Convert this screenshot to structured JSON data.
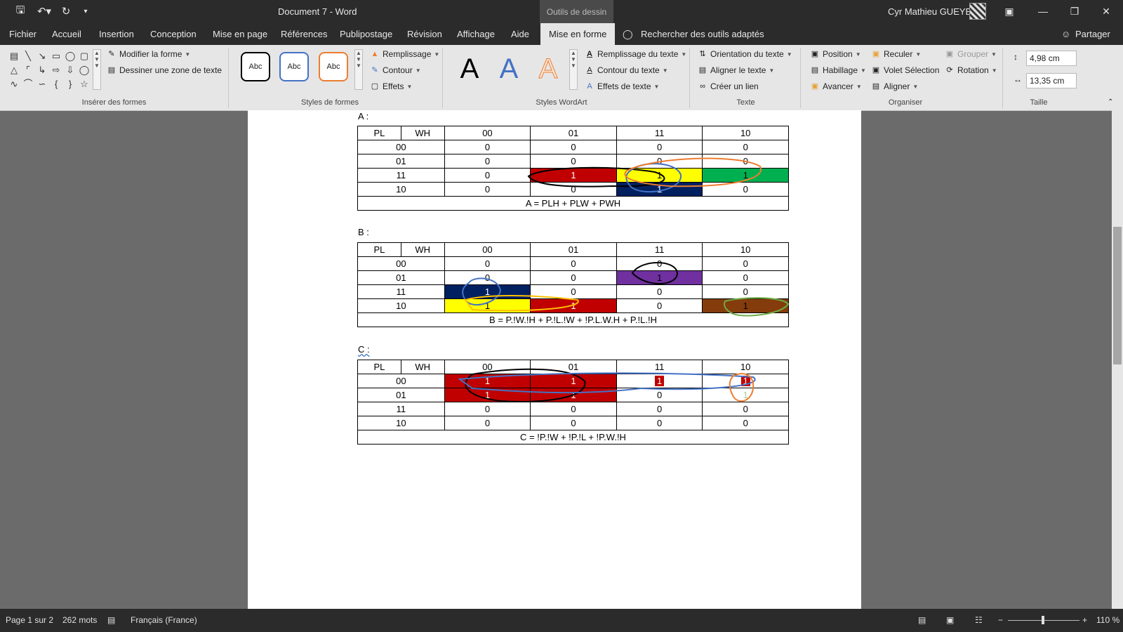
{
  "app": {
    "doc_title": "Document 7  -  Word",
    "contextual_tab": "Outils de dessin",
    "user": "Cyr Mathieu GUEYE"
  },
  "tabs": [
    "Fichier",
    "Accueil",
    "Insertion",
    "Conception",
    "Mise en page",
    "Références",
    "Publipostage",
    "Révision",
    "Affichage",
    "Aide",
    "Mise en forme"
  ],
  "tell_me": "Rechercher des outils adaptés",
  "share": "Partager",
  "ribbon": {
    "insert_shapes": {
      "edit_shape": "Modifier la forme",
      "draw_textbox": "Dessiner une zone de texte",
      "label": "Insérer des formes"
    },
    "shape_styles": {
      "sample": "Abc",
      "fill": "Remplissage",
      "outline": "Contour",
      "effects": "Effets",
      "label": "Styles de formes"
    },
    "wordart": {
      "sample": "A",
      "text_fill": "Remplissage du texte",
      "text_outline": "Contour du texte",
      "text_effects": "Effets de texte",
      "label": "Styles WordArt"
    },
    "text": {
      "orientation": "Orientation du texte",
      "align": "Aligner le texte",
      "link": "Créer un lien",
      "label": "Texte"
    },
    "arrange": {
      "position": "Position",
      "wrap": "Habillage",
      "forward": "Avancer",
      "backward": "Reculer",
      "selection_pane": "Volet Sélection",
      "align": "Aligner",
      "group": "Grouper",
      "rotate": "Rotation",
      "label": "Organiser"
    },
    "size": {
      "height": "4,98 cm",
      "width": "13,35 cm",
      "label": "Taille"
    }
  },
  "document": {
    "header_cols": [
      "PL",
      "WH",
      "00",
      "01",
      "11",
      "10"
    ],
    "row_labels": [
      "00",
      "01",
      "11",
      "10"
    ],
    "tables": [
      {
        "label": "A :",
        "rows": [
          [
            "0",
            "0",
            "0",
            "0"
          ],
          [
            "0",
            "0",
            "0",
            "0"
          ],
          [
            "0",
            "1",
            "1",
            "1"
          ],
          [
            "0",
            "0",
            "1",
            "0"
          ]
        ],
        "equation": "A = PLH + PLW + PWH"
      },
      {
        "label": "B :",
        "rows": [
          [
            "0",
            "0",
            "0",
            "0"
          ],
          [
            "0",
            "0",
            "1",
            "0"
          ],
          [
            "1",
            "0",
            "0",
            "0"
          ],
          [
            "1",
            "1",
            "0",
            "1"
          ]
        ],
        "equation": "B = P.!W.!H + P.!L.!W + !P.L.W.H + P.!L.!H"
      },
      {
        "label": "C :",
        "rows": [
          [
            "1",
            "1",
            "1",
            "1"
          ],
          [
            "1",
            "1",
            "0",
            "1"
          ],
          [
            "0",
            "0",
            "0",
            "0"
          ],
          [
            "0",
            "0",
            "0",
            "0"
          ]
        ],
        "equation": "C = !P.!W + !P.!L + !P.W.!H"
      }
    ]
  },
  "status": {
    "page": "Page 1 sur 2",
    "words": "262 mots",
    "language": "Français (France)",
    "zoom": "110 %"
  },
  "colors": {
    "red": "#c00000",
    "yellow": "#ffff00",
    "green": "#00b050",
    "navy": "#002060",
    "purple": "#7030a0",
    "brown": "#843c0c"
  }
}
